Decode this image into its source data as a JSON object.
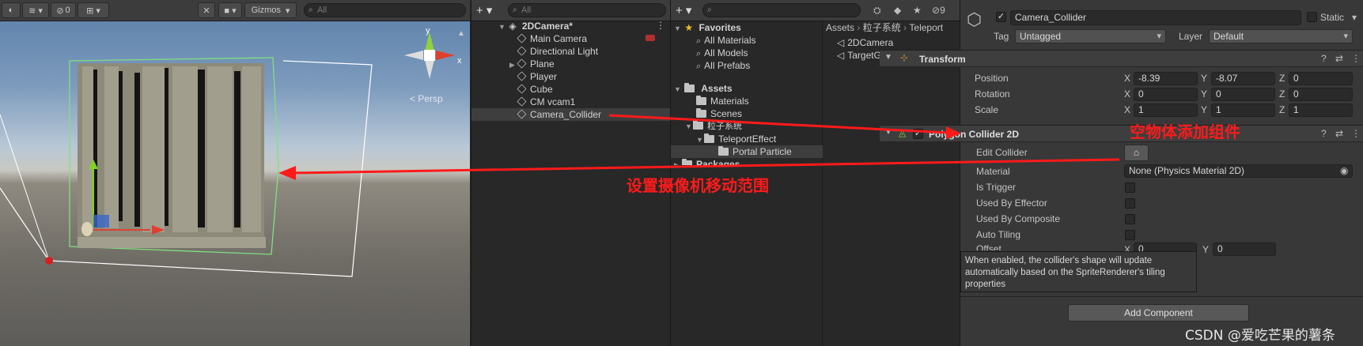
{
  "scene_toolbar": {
    "tools": [
      "draw-mode-icon",
      "layers-icon",
      "hidden-objects-icon",
      "grid-icon"
    ],
    "hidden_count": "0",
    "gizmos_label": "Gizmos",
    "search_placeholder": "All",
    "persp_label": "< Persp",
    "axis_x": "x",
    "axis_y": "y"
  },
  "hierarchy": {
    "add_label": "+ ▾",
    "search_placeholder": "All",
    "scene_name": "2DCamera*",
    "items": [
      "Main Camera",
      "Directional Light",
      "Plane",
      "Player",
      "Cube",
      "CM vcam1",
      "Camera_Collider"
    ]
  },
  "project": {
    "add_label": "+ ▾",
    "favorites_label": "Favorites",
    "favorites": [
      "All Materials",
      "All Models",
      "All Prefabs"
    ],
    "assets_label": "Assets",
    "folders": [
      "Materials",
      "Scenes",
      "粒子系统",
      "TeleportEffect",
      "Portal Particle",
      "Packages"
    ],
    "breadcrumb": [
      "Assets",
      "粒子系统",
      "Teleport"
    ],
    "files": [
      "2DCamera",
      "TargetGroupCamera"
    ],
    "hidden_count": "9"
  },
  "inspector": {
    "object_name": "Camera_Collider",
    "static_label": "Static",
    "tag_label": "Tag",
    "tag_value": "Untagged",
    "layer_label": "Layer",
    "layer_value": "Default",
    "transform": {
      "title": "Transform",
      "rows": [
        {
          "label": "Position",
          "x": "-8.39",
          "y": "-8.07",
          "z": "0"
        },
        {
          "label": "Rotation",
          "x": "0",
          "y": "0",
          "z": "0"
        },
        {
          "label": "Scale",
          "x": "1",
          "y": "1",
          "z": "1"
        }
      ]
    },
    "collider": {
      "title": "Polygon Collider 2D",
      "edit_label": "Edit Collider",
      "material_label": "Material",
      "material_value": "None (Physics Material 2D)",
      "bool_labels": [
        "Is Trigger",
        "Used By Effector",
        "Used By Composite",
        "Auto Tiling"
      ],
      "offset_label": "Offset",
      "offset_x": "0",
      "offset_y": "0"
    },
    "tooltip": "When enabled, the collider's shape will update automatically based on the SpriteRenderer's tiling properties",
    "add_component": "Add Component",
    "axis": [
      "X",
      "Y",
      "Z"
    ]
  },
  "annotations": {
    "add_component_note": "空物体添加组件",
    "camera_range_note": "设置摄像机移动范围",
    "color": "#ff1a1a"
  },
  "watermark": "CSDN @爱吃芒果的薯条"
}
